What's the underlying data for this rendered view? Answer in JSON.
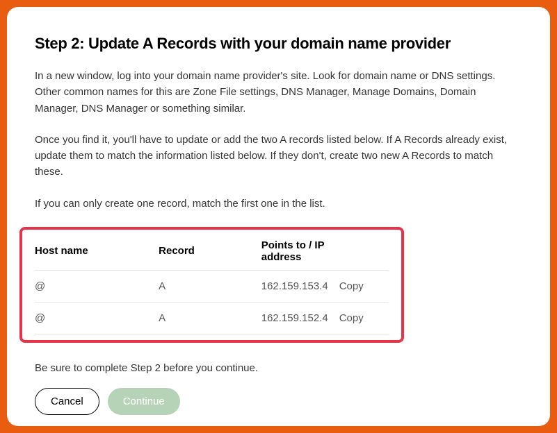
{
  "title": "Step 2: Update A Records with your domain name provider",
  "paragraphs": {
    "p1": "In a new window, log into your domain name provider's site. Look for domain name or DNS settings. Other common names for this are Zone File settings, DNS Manager, Manage Domains, Domain Manager, DNS Manager or something similar.",
    "p2": "Once you find it, you'll have to update or add the two A records listed below. If A Records already exist, update them to match the information listed below. If they don't, create two new A Records to match these.",
    "p3": "If you can only create one record, match the first one in the list."
  },
  "table": {
    "headers": {
      "host": "Host name",
      "record": "Record",
      "ip": "Points to / IP address"
    },
    "rows": [
      {
        "host": "@",
        "record": "A",
        "ip": "162.159.153.4",
        "copy": "Copy"
      },
      {
        "host": "@",
        "record": "A",
        "ip": "162.159.152.4",
        "copy": "Copy"
      }
    ]
  },
  "reminder": "Be sure to complete Step 2 before you continue.",
  "buttons": {
    "cancel": "Cancel",
    "continue": "Continue"
  }
}
